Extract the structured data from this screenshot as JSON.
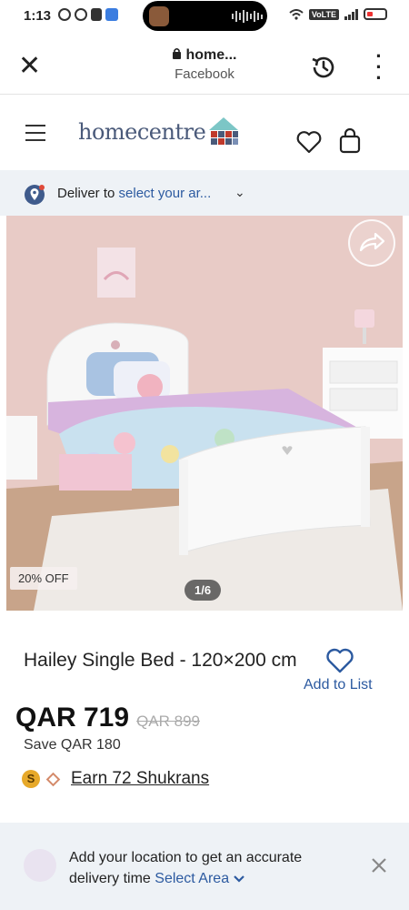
{
  "status_bar": {
    "time": "1:13",
    "network_label": "VoLTE"
  },
  "browser": {
    "url": "home...",
    "site": "Facebook"
  },
  "header": {
    "logo_text": "homecentre"
  },
  "delivery": {
    "prefix": "Deliver to",
    "link": "select your ar..."
  },
  "product": {
    "discount_badge": "20% OFF",
    "image_counter": "1/6",
    "title": "Hailey Single Bed - 120×200 cm",
    "add_to_list": "Add to List",
    "price": "QAR 719",
    "old_price": "QAR 899",
    "save_text": "Save QAR 180",
    "shukran_coin": "S",
    "shukran_text": "Earn 72 Shukrans"
  },
  "location_banner": {
    "text": "Add your location to get an accurate delivery time",
    "link": "Select Area"
  },
  "colors": {
    "brand_blue": "#2c5aa0",
    "logo_text": "#4a5a7a",
    "banner_bg": "#eef2f6"
  }
}
